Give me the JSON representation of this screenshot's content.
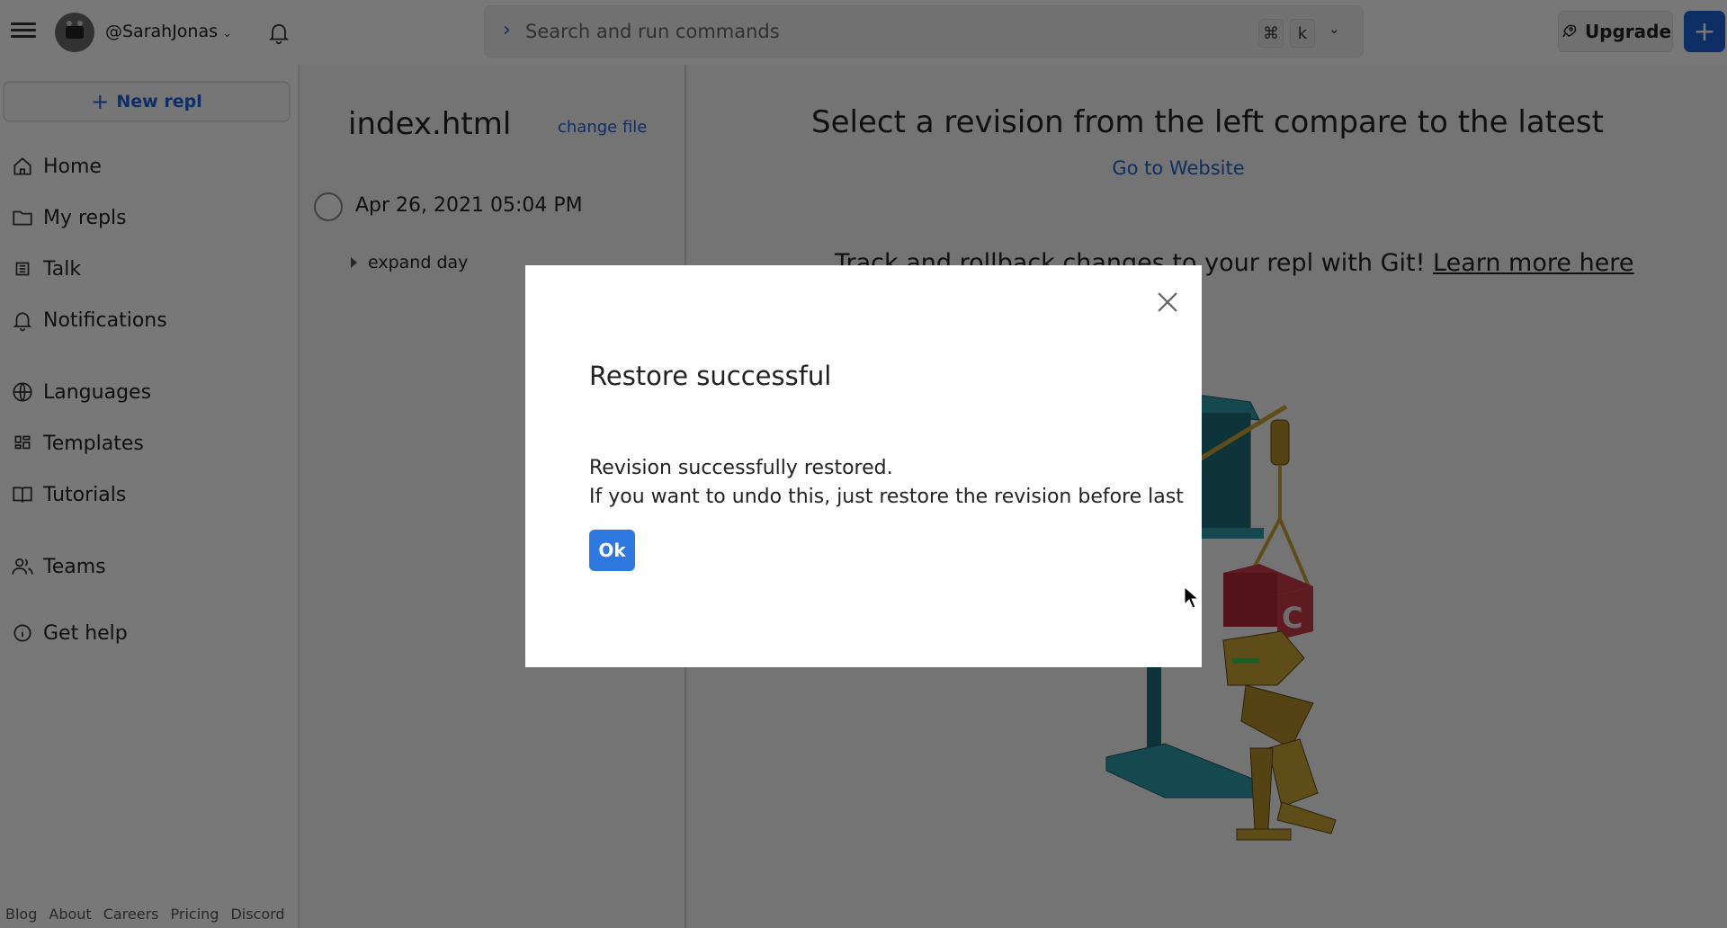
{
  "topbar": {
    "username": "@SarahJonas",
    "search_placeholder": "Search and run commands",
    "shortcut_keys": [
      "⌘",
      "k"
    ],
    "upgrade_label": "Upgrade",
    "new_button_label": "+"
  },
  "sidebar": {
    "new_repl_label": "New repl",
    "items": [
      {
        "label": "Home",
        "icon": "home-icon"
      },
      {
        "label": "My repls",
        "icon": "folder-icon"
      },
      {
        "label": "Talk",
        "icon": "talk-icon"
      },
      {
        "label": "Notifications",
        "icon": "bell-icon"
      },
      {
        "label": "Languages",
        "icon": "globe-icon"
      },
      {
        "label": "Templates",
        "icon": "templates-icon"
      },
      {
        "label": "Tutorials",
        "icon": "book-icon"
      },
      {
        "label": "Teams",
        "icon": "team-icon"
      },
      {
        "label": "Get help",
        "icon": "info-icon"
      }
    ],
    "footer_links": [
      "Blog",
      "About",
      "Careers",
      "Pricing",
      "Discord"
    ]
  },
  "revisions": {
    "filename": "index.html",
    "change_file_label": "change file",
    "entries": [
      {
        "date": "Apr 26, 2021 05:04 PM",
        "expand_label": "expand day"
      }
    ]
  },
  "main": {
    "title": "Select a revision from the left compare to the latest",
    "go_to_website_label": "Go to Website",
    "git_text": "Track and rollback changes to your repl with Git! ",
    "git_link": "Learn more here"
  },
  "modal": {
    "title": "Restore successful",
    "body_line1": "Revision successfully restored.",
    "body_line2": "If you want to undo this, just restore the revision before last",
    "ok_label": "Ok"
  },
  "colors": {
    "accent": "#1f63d8",
    "ok_button": "#2e79e0",
    "overlay": "rgba(0,0,0,0.53)"
  }
}
